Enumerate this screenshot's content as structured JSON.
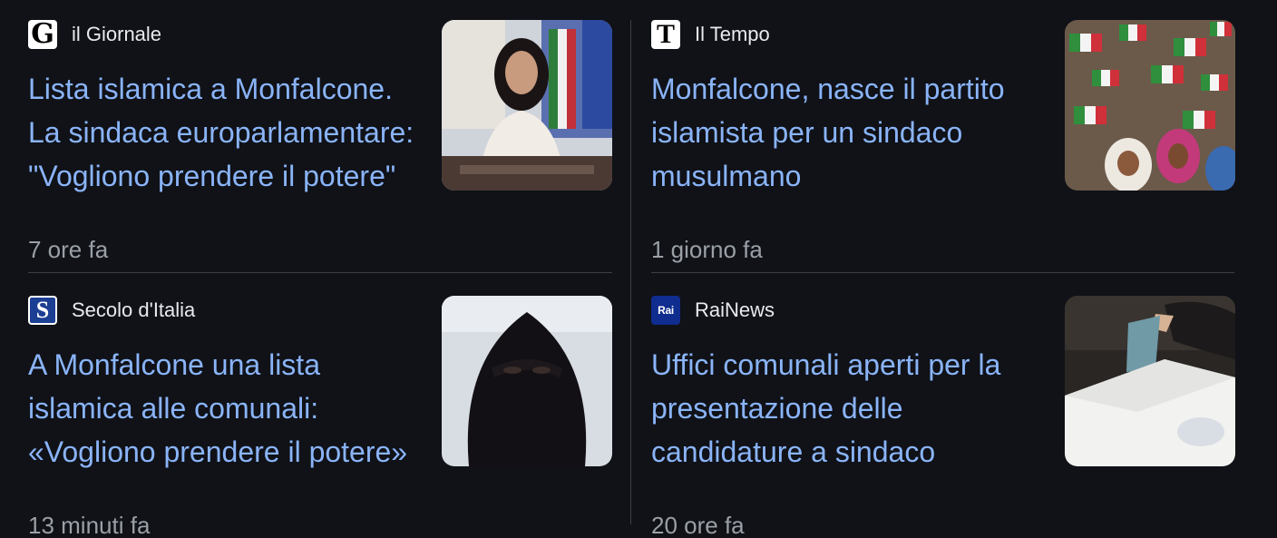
{
  "articles": [
    {
      "source": "il Giornale",
      "logo_letter": "G",
      "headline": "Lista islamica a Monfalcone. La sindaca europarlamentare: \"Vogliono prendere il potere\"",
      "time": "7 ore fa",
      "thumbnail": "woman-at-desk-with-flags"
    },
    {
      "source": "Il Tempo",
      "logo_letter": "T",
      "headline": "Monfalcone, nasce il partito islamista per un sindaco musulmano",
      "time": "1 giorno fa",
      "thumbnail": "crowd-with-italian-flags"
    },
    {
      "source": "Secolo d'Italia",
      "logo_letter": "S",
      "headline": "A Monfalcone una lista islamica alle comunali: «Vogliono prendere il potere»",
      "time": "13 minuti fa",
      "thumbnail": "woman-in-niqab"
    },
    {
      "source": "RaiNews",
      "logo_letter": "Rai",
      "headline": "Uffici comunali aperti per la presentazione delle candidature a sindaco",
      "time": "20 ore fa",
      "thumbnail": "ballot-box"
    }
  ],
  "colors": {
    "background": "#101218",
    "headline": "#8ab4f8",
    "source": "#e8eaed",
    "time": "#9aa0a6",
    "divider": "#3c4043"
  }
}
